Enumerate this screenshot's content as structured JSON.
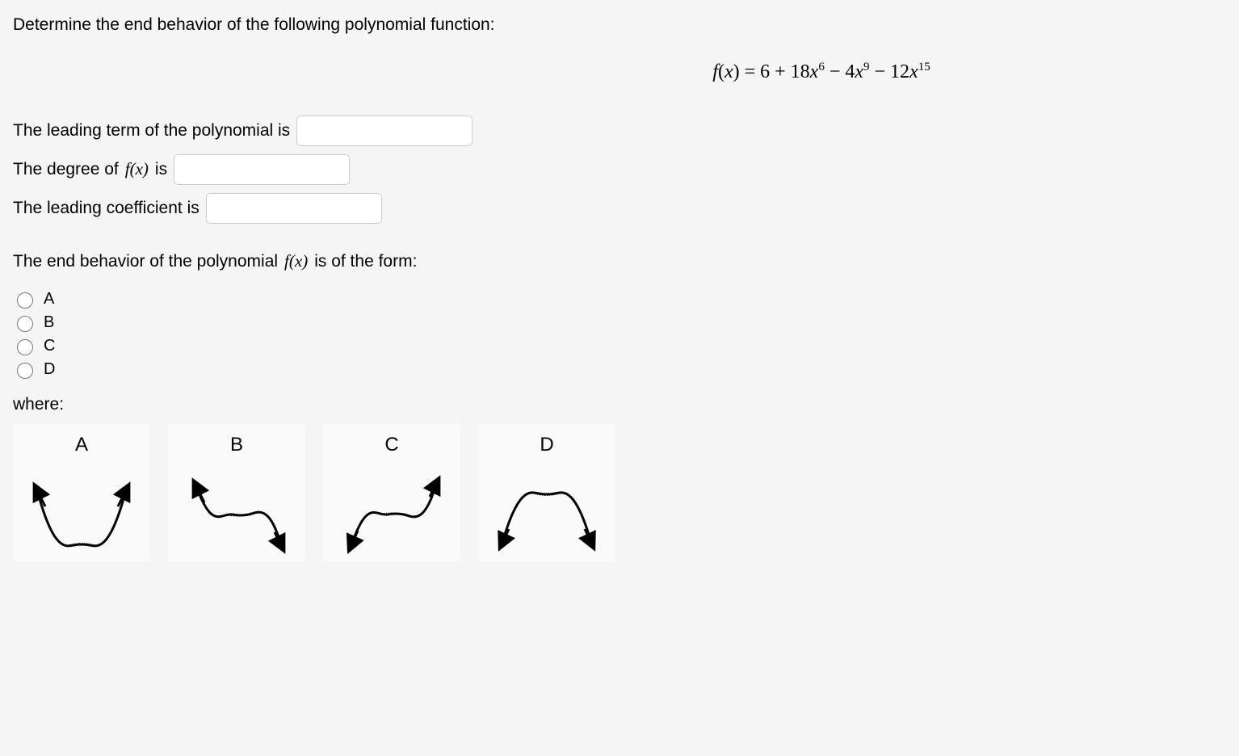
{
  "question": "Determine the end behavior of the following polynomial function:",
  "formula_html": "<span class='fx'>f</span>(<span class='fx'>x</span>) = 6 + 18<span class='fx'>x</span><sup>6</sup> − 4<span class='fx'>x</span><sup>9</sup> − 12<span class='fx'>x</span><sup>15</sup>",
  "text": {
    "leading_term_pre": "The leading term of the polynomial is",
    "degree_pre": "The degree of ",
    "degree_mid": " is",
    "fx_math": "f(x)",
    "coeff_pre": "The leading coefficient is",
    "end_behavior_pre": "The end behavior of the polynomial ",
    "end_behavior_post": " is of the form:",
    "where": "where:"
  },
  "options": [
    "A",
    "B",
    "C",
    "D"
  ],
  "diagrams": [
    "A",
    "B",
    "C",
    "D"
  ],
  "inputs": {
    "leading_term": "",
    "degree": "",
    "coefficient": ""
  }
}
